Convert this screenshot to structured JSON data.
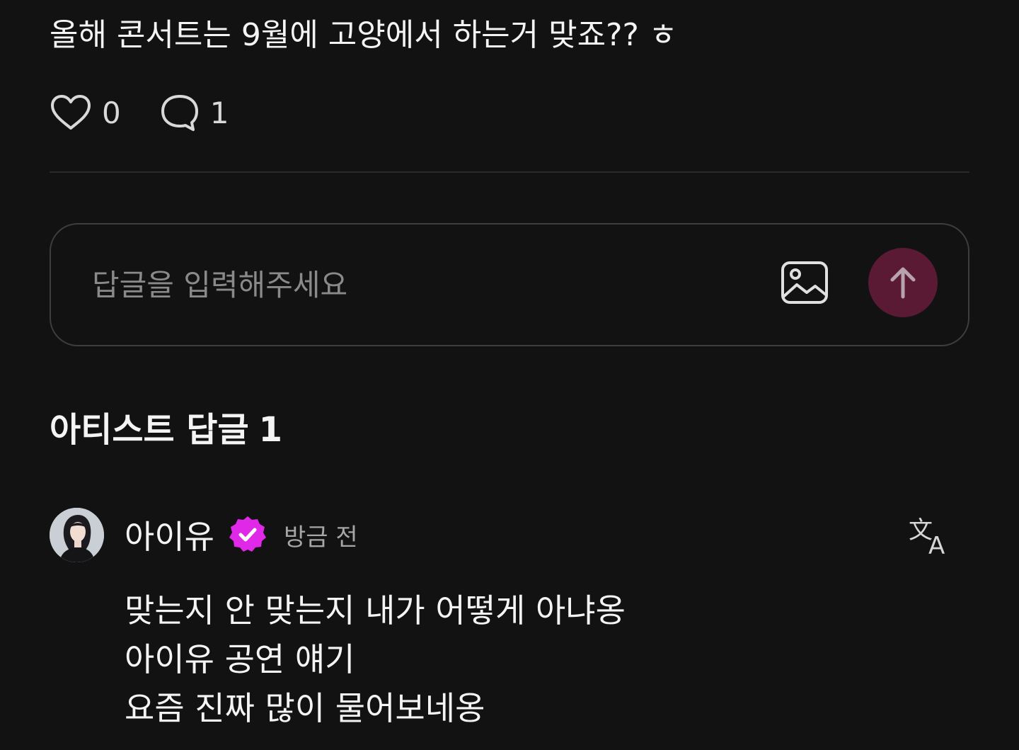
{
  "post": {
    "text": "올해 콘서트는 9월에 고양에서 하는거 맞죠?? ㅎ",
    "like_count": "0",
    "comment_count": "1"
  },
  "reply_box": {
    "placeholder": "답글을 입력해주세요",
    "image_icon": "image-icon",
    "send_icon": "arrow-up-icon"
  },
  "artist_replies": {
    "title": "아티스트 답글",
    "count": "1"
  },
  "reply": {
    "author": "아이유",
    "badge_icon": "verified-badge-icon",
    "timestamp": "방금 전",
    "lines": [
      "맞는지 안 맞는지 내가 어떻게 아냐옹",
      "아이유 공연 얘기",
      "요즘 진짜 많이 물어보네옹"
    ]
  },
  "colors": {
    "background": "#121212",
    "send_button": "#5a1a33",
    "verified_badge": "#e028e8"
  }
}
